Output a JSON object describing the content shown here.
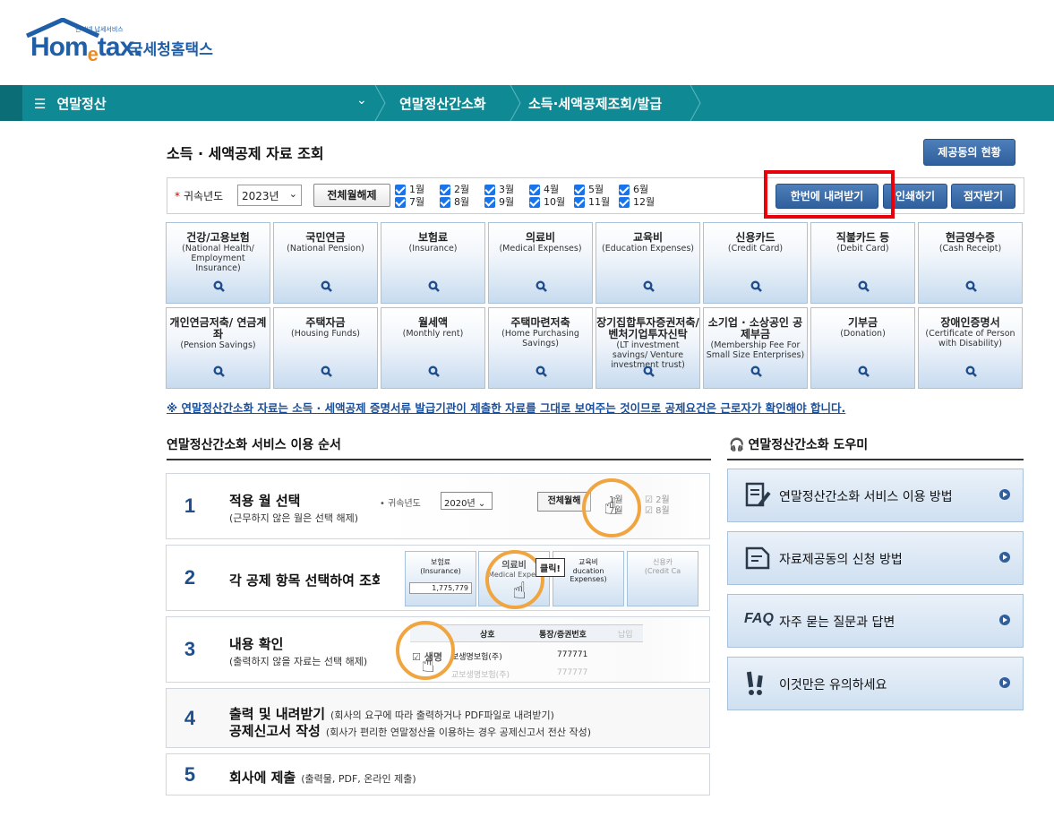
{
  "logo": {
    "small_text": "인터넷 납세서비스",
    "wordmark_pre": "Hom",
    "wordmark_e": "e",
    "wordmark_post": "tax.",
    "korean": "국세청홈택스"
  },
  "nav": {
    "menu_label": "연말정산",
    "crumbs": [
      "연말정산간소화",
      "소득·세액공제조회/발급"
    ]
  },
  "page": {
    "title": "소득 · 세액공제 자료 조회",
    "status_button": "제공동의 현황"
  },
  "filter": {
    "year_label": "귀속년도",
    "year_value": "2023년",
    "uncheck_all": "전체월해제",
    "months": [
      "1월",
      "2월",
      "3월",
      "4월",
      "5월",
      "6월",
      "7월",
      "8월",
      "9월",
      "10월",
      "11월",
      "12월"
    ],
    "download": "한번에 내려받기",
    "print": "인쇄하기",
    "braille": "점자받기"
  },
  "tiles": [
    {
      "kr": "건강/고용보험",
      "en": "(National Health/ Employment Insurance)"
    },
    {
      "kr": "국민연금",
      "en": "(National Pension)"
    },
    {
      "kr": "보험료",
      "en": "(Insurance)"
    },
    {
      "kr": "의료비",
      "en": "(Medical Expenses)"
    },
    {
      "kr": "교육비",
      "en": "(Education Expenses)"
    },
    {
      "kr": "신용카드",
      "en": "(Credit Card)"
    },
    {
      "kr": "직불카드 등",
      "en": "(Debit Card)"
    },
    {
      "kr": "현금영수증",
      "en": "(Cash Receipt)"
    },
    {
      "kr": "개인연금저축/ 연금계좌",
      "en": "(Pension Savings)"
    },
    {
      "kr": "주택자금",
      "en": "(Housing Funds)"
    },
    {
      "kr": "월세액",
      "en": "(Monthly rent)"
    },
    {
      "kr": "주택마련저축",
      "en": "(Home Purchasing Savings)"
    },
    {
      "kr": "장기집합투자증권저축/ 벤처기업투자신탁",
      "en": "(LT investment savings/ Venture investment trust)"
    },
    {
      "kr": "소기업 · 소상공인 공제부금",
      "en": "(Membership Fee For Small Size Enterprises)"
    },
    {
      "kr": "기부금",
      "en": "(Donation)"
    },
    {
      "kr": "장애인증명서",
      "en": "(Certificate of Person with Disability)"
    }
  ],
  "notice": "※ 연말정산간소화 자료는 소득 · 세액공제 증명서류 발급기관이 제출한 자료를 그대로 보여주는 것이므로 공제요건은 근로자가 확인해야 합니다.",
  "steps_title": "연말정산간소화 서비스 이용 순서",
  "steps": [
    {
      "num": "1",
      "title": "적용 월 선택",
      "desc": "(근무하지 않은 월은 선택 해제)"
    },
    {
      "num": "2",
      "title": "각 공제 항목 선택하여 조회",
      "desc": ""
    },
    {
      "num": "3",
      "title": "내용 확인",
      "desc": "(출력하지 않을 자료는 선택 해제)"
    },
    {
      "num": "4",
      "title": "출력 및 내려받기",
      "desc": "(회사의 요구에 따라 출력하거나 PDF파일로 내려받기)",
      "title2": "공제신고서 작성",
      "desc2": "(회사가 편리한 연말정산을 이용하는 경우 공제신고서 전산 작성)"
    },
    {
      "num": "5",
      "title": "회사에 제출",
      "desc": "(출력물, PDF, 온라인 제출)"
    }
  ],
  "illus": {
    "s1": {
      "year_label": "귀속년도",
      "year": "2020년",
      "btn": "전체월해",
      "m1": "1월",
      "m2": "2월",
      "m7": "7월",
      "m8": "8월"
    },
    "s2": {
      "t1_kr": "보험료",
      "t1_en": "(Insurance)",
      "t1_val": "1,775,779",
      "t2_kr": "의료비",
      "t2_en": "Medical Expen",
      "t3_kr": "교육비",
      "t3_en": "ducation Expenses)",
      "t4_kr": "신용카",
      "t4_en": "(Credit Ca",
      "tooltip": "클릭!"
    },
    "s3": {
      "col1": "상호",
      "col2": "통장/증권번호",
      "col3": "납입",
      "row1_name": "생명",
      "row1_company": "보생명보험(주)",
      "row1_no": "777771",
      "row2_company": "교보생명보험(주)",
      "row2_no": "777777"
    }
  },
  "helper_title": "연말정산간소화 도우미",
  "helpers": [
    {
      "icon": "document-edit-icon",
      "label": "연말정산간소화 서비스 이용 방법"
    },
    {
      "icon": "document-icon",
      "label": "자료제공동의 신청 방법"
    },
    {
      "icon": "faq-icon",
      "icon_text": "FAQ",
      "label": "자주 묻는 질문과 답변"
    },
    {
      "icon": "exclamation-icon",
      "label": "이것만은 유의하세요"
    }
  ],
  "colors": {
    "nav": "#0f8a94",
    "button": "#2f5f9c",
    "highlight": "#e8000b",
    "ring": "#f0a540",
    "notice": "#1a4f9c"
  }
}
